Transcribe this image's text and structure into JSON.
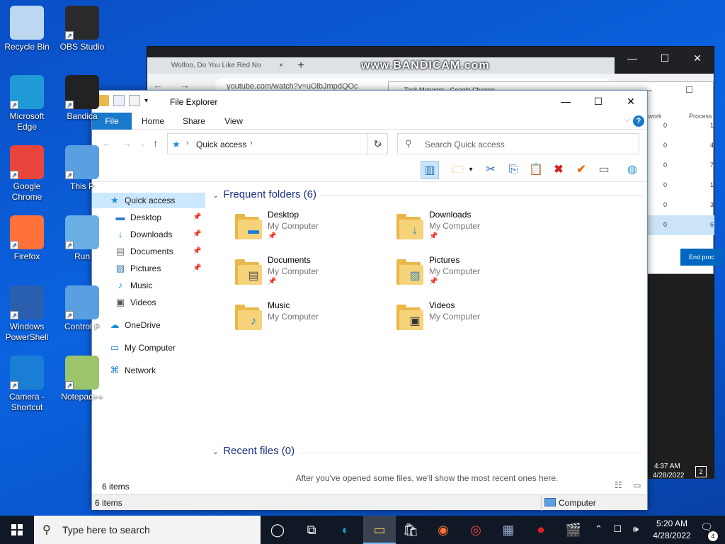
{
  "desktop": {
    "icons": [
      {
        "label": "Recycle Bin",
        "icon": "recycle-bin-icon",
        "color": "#bcd8f0"
      },
      {
        "label": "OBS Studio",
        "icon": "obs-icon",
        "color": "#2b2b2b"
      },
      {
        "label": "Microsoft Edge",
        "icon": "edge-icon",
        "color": "#1f9ad6"
      },
      {
        "label": "Bandica",
        "icon": "bandicam-icon",
        "color": "#222222"
      },
      {
        "label": "Google Chrome",
        "icon": "chrome-icon",
        "color": "#e8453c"
      },
      {
        "label": "This P",
        "icon": "this-pc-icon",
        "color": "#5aa0e0"
      },
      {
        "label": "Firefox",
        "icon": "firefox-icon",
        "color": "#ff7139"
      },
      {
        "label": "Run",
        "icon": "run-icon",
        "color": "#6aaee6"
      },
      {
        "label": "Windows PowerShell",
        "icon": "powershell-icon",
        "color": "#2a5fb0"
      },
      {
        "label": "Control P",
        "icon": "control-panel-icon",
        "color": "#5aa0e0"
      },
      {
        "label": "Camera - Shortcut",
        "icon": "camera-icon",
        "color": "#1a7fd4"
      },
      {
        "label": "Notepad++",
        "icon": "notepadpp-icon",
        "color": "#9cc46a"
      }
    ]
  },
  "watermark": "www.BANDICAM.com",
  "chrome": {
    "tab_title": "Wolfoo, Do You Like Red No",
    "tab_close": "×",
    "new_tab": "+",
    "url": "youtube.com/watch?v=uOlbJmpdQOc",
    "controls": [
      "—",
      "☐",
      "✕"
    ]
  },
  "taskmgr": {
    "title": "Task Manager - Google Chrome",
    "controls": "— ☐",
    "col_network": "twork",
    "col_process": "Process",
    "rows": [
      {
        "net": "0",
        "proc": "1"
      },
      {
        "net": "0",
        "proc": "4"
      },
      {
        "net": "0",
        "proc": "7"
      },
      {
        "net": "0",
        "proc": "1"
      },
      {
        "net": "0",
        "proc": "3"
      },
      {
        "net": "0",
        "proc": "6"
      }
    ],
    "end_button": "End proc"
  },
  "bg_clock": {
    "time": "4:37 AM",
    "date": "4/28/2022",
    "notif": "2"
  },
  "explorer": {
    "title": "File Explorer",
    "qat_dropdown": "▾",
    "window_controls": {
      "minimize": "—",
      "maximize": "☐",
      "close": "✕"
    },
    "ribbon": {
      "tabs": [
        "File",
        "Home",
        "Share",
        "View"
      ],
      "chevron": "⌵",
      "help": "?"
    },
    "nav": {
      "back": "←",
      "forward": "→",
      "recent": "⌄",
      "up": "↑"
    },
    "address": {
      "icon": "★",
      "sep": "›",
      "path": "Quick access",
      "dropdown": "⌄"
    },
    "refresh": "↻",
    "search": {
      "placeholder": "Search Quick access",
      "icon": "⚲"
    },
    "toolbar": {
      "preview_pane": "▥",
      "new_folder": "🗁",
      "dropdown": "▾",
      "cut": "✂",
      "copy": "⎘",
      "paste": "📋",
      "delete": "✖",
      "check": "✔",
      "rename": "▭",
      "shell": "◍"
    },
    "navpane": {
      "items": [
        {
          "label": "Quick access",
          "icon": "★",
          "pin": ""
        },
        {
          "label": "Desktop",
          "icon": "▬",
          "pin": "📌"
        },
        {
          "label": "Downloads",
          "icon": "↓",
          "pin": "📌"
        },
        {
          "label": "Documents",
          "icon": "▤",
          "pin": "📌"
        },
        {
          "label": "Pictures",
          "icon": "▨",
          "pin": "📌"
        },
        {
          "label": "Music",
          "icon": "♪",
          "pin": ""
        },
        {
          "label": "Videos",
          "icon": "▣",
          "pin": ""
        },
        {
          "label": "OneDrive",
          "icon": "☁",
          "pin": ""
        },
        {
          "label": "My Computer",
          "icon": "▭",
          "pin": ""
        },
        {
          "label": "Network",
          "icon": "⌘",
          "pin": ""
        }
      ]
    },
    "frequent": {
      "header": "Frequent folders (6)",
      "chevron": "⌄",
      "folders": [
        {
          "name": "Desktop",
          "location": "My Computer",
          "pinned": "📌",
          "overlay": "▬"
        },
        {
          "name": "Downloads",
          "location": "My Computer",
          "pinned": "📌",
          "overlay": "↓"
        },
        {
          "name": "Documents",
          "location": "My Computer",
          "pinned": "📌",
          "overlay": "▤"
        },
        {
          "name": "Pictures",
          "location": "My Computer",
          "pinned": "📌",
          "overlay": "▨"
        },
        {
          "name": "Music",
          "location": "My Computer",
          "pinned": "",
          "overlay": "♪"
        },
        {
          "name": "Videos",
          "location": "My Computer",
          "pinned": "",
          "overlay": "▣"
        }
      ]
    },
    "recent": {
      "header": "Recent files (0)",
      "chevron": "⌄",
      "empty_text": "After you've opened some files, we'll show the most recent ones here."
    },
    "status_items": "6 items",
    "view_icons": "☷ ▭",
    "statusbar": {
      "items": "6 items",
      "location": "Computer"
    }
  },
  "taskbar": {
    "search_placeholder": "Type here to search",
    "search_icon": "⚲",
    "apps": [
      {
        "name": "task-view",
        "glyph": "◯"
      },
      {
        "name": "timeline",
        "glyph": "⧉"
      },
      {
        "name": "edge",
        "glyph": "◐"
      },
      {
        "name": "file-explorer",
        "glyph": "▭"
      },
      {
        "name": "store",
        "glyph": "🛍"
      },
      {
        "name": "firefox",
        "glyph": "◉"
      },
      {
        "name": "chrome",
        "glyph": "◎"
      },
      {
        "name": "control-panel",
        "glyph": "▦"
      },
      {
        "name": "bandicam",
        "glyph": "⏺"
      },
      {
        "name": "clapper",
        "glyph": "🎬"
      }
    ],
    "tray_icons": "⌃ ☐ 🕪",
    "time": "5:20 AM",
    "date": "4/28/2022",
    "notif_icon": "🗨",
    "notif_count": "4"
  }
}
